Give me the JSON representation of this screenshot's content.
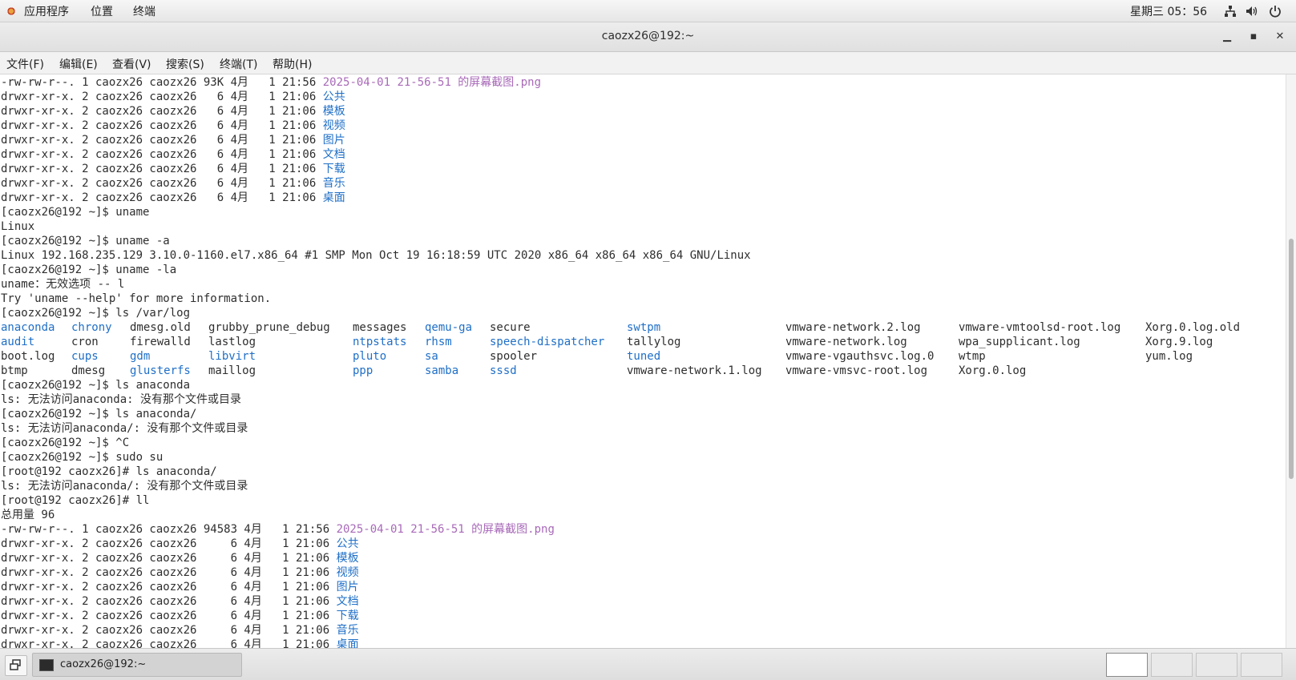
{
  "top_panel": {
    "applications": "应用程序",
    "places": "位置",
    "terminal": "终端",
    "clock": "星期三 05：56"
  },
  "window": {
    "title": "caozx26@192:~",
    "minimize": "▁",
    "maximize": "▪",
    "close": "✕"
  },
  "menubar": {
    "file": "文件(F)",
    "edit": "编辑(E)",
    "view": "查看(V)",
    "search": "搜索(S)",
    "terminal": "终端(T)",
    "help": "帮助(H)"
  },
  "terminal": {
    "lines": [
      {
        "text": "-rw-rw-r--. 1 caozx26 caozx26 93K 4月   1 21:56 ",
        "name": "2025-04-01 21-56-51 的屏幕截图.png",
        "kind": "img"
      },
      {
        "text": "drwxr-xr-x. 2 caozx26 caozx26   6 4月   1 21:06 ",
        "name": "公共",
        "kind": "dir"
      },
      {
        "text": "drwxr-xr-x. 2 caozx26 caozx26   6 4月   1 21:06 ",
        "name": "模板",
        "kind": "dir"
      },
      {
        "text": "drwxr-xr-x. 2 caozx26 caozx26   6 4月   1 21:06 ",
        "name": "视频",
        "kind": "dir"
      },
      {
        "text": "drwxr-xr-x. 2 caozx26 caozx26   6 4月   1 21:06 ",
        "name": "图片",
        "kind": "dir"
      },
      {
        "text": "drwxr-xr-x. 2 caozx26 caozx26   6 4月   1 21:06 ",
        "name": "文档",
        "kind": "dir"
      },
      {
        "text": "drwxr-xr-x. 2 caozx26 caozx26   6 4月   1 21:06 ",
        "name": "下载",
        "kind": "dir"
      },
      {
        "text": "drwxr-xr-x. 2 caozx26 caozx26   6 4月   1 21:06 ",
        "name": "音乐",
        "kind": "dir"
      },
      {
        "text": "drwxr-xr-x. 2 caozx26 caozx26   6 4月   1 21:06 ",
        "name": "桌面",
        "kind": "dir"
      },
      {
        "text": "[caozx26@192 ~]$ uname"
      },
      {
        "text": "Linux"
      },
      {
        "text": "[caozx26@192 ~]$ uname -a"
      },
      {
        "text": "Linux 192.168.235.129 3.10.0-1160.el7.x86_64 #1 SMP Mon Oct 19 16:18:59 UTC 2020 x86_64 x86_64 x86_64 GNU/Linux"
      },
      {
        "text": "[caozx26@192 ~]$ uname -la"
      },
      {
        "text": "uname：无效选项 -- l"
      },
      {
        "text": "Try 'uname --help' for more information."
      },
      {
        "text": "[caozx26@192 ~]$ ls /var/log"
      },
      {
        "cols": [
          {
            "t": "anaconda",
            "kind": "dir"
          },
          {
            "t": "chrony",
            "kind": "dir"
          },
          {
            "t": "dmesg.old"
          },
          {
            "t": "grubby_prune_debug"
          },
          {
            "t": "messages"
          },
          {
            "t": "qemu-ga",
            "kind": "dir"
          },
          {
            "t": "secure"
          },
          {
            "t": "swtpm",
            "kind": "dir"
          },
          {
            "t": "vmware-network.2.log"
          },
          {
            "t": "vmware-vmtoolsd-root.log"
          },
          {
            "t": "Xorg.0.log.old"
          }
        ]
      },
      {
        "cols": [
          {
            "t": "audit",
            "kind": "dir"
          },
          {
            "t": "cron"
          },
          {
            "t": "firewalld"
          },
          {
            "t": "lastlog"
          },
          {
            "t": "ntpstats",
            "kind": "dir"
          },
          {
            "t": "rhsm",
            "kind": "dir"
          },
          {
            "t": "speech-dispatcher",
            "kind": "dir"
          },
          {
            "t": "tallylog"
          },
          {
            "t": "vmware-network.log"
          },
          {
            "t": "wpa_supplicant.log"
          },
          {
            "t": "Xorg.9.log"
          }
        ]
      },
      {
        "cols": [
          {
            "t": "boot.log"
          },
          {
            "t": "cups",
            "kind": "dir"
          },
          {
            "t": "gdm",
            "kind": "dir"
          },
          {
            "t": "libvirt",
            "kind": "dir"
          },
          {
            "t": "pluto",
            "kind": "dir"
          },
          {
            "t": "sa",
            "kind": "dir"
          },
          {
            "t": "spooler"
          },
          {
            "t": "tuned",
            "kind": "dir"
          },
          {
            "t": "vmware-vgauthsvc.log.0"
          },
          {
            "t": "wtmp"
          },
          {
            "t": "yum.log"
          }
        ]
      },
      {
        "cols": [
          {
            "t": "btmp"
          },
          {
            "t": "dmesg"
          },
          {
            "t": "glusterfs",
            "kind": "dir"
          },
          {
            "t": "maillog"
          },
          {
            "t": "ppp",
            "kind": "dir"
          },
          {
            "t": "samba",
            "kind": "dir"
          },
          {
            "t": "sssd",
            "kind": "dir"
          },
          {
            "t": "vmware-network.1.log"
          },
          {
            "t": "vmware-vmsvc-root.log"
          },
          {
            "t": "Xorg.0.log"
          },
          {
            "t": ""
          }
        ]
      },
      {
        "text": "[caozx26@192 ~]$ ls anaconda"
      },
      {
        "text": "ls: 无法访问anaconda: 没有那个文件或目录"
      },
      {
        "text": "[caozx26@192 ~]$ ls anaconda/"
      },
      {
        "text": "ls: 无法访问anaconda/: 没有那个文件或目录"
      },
      {
        "text": "[caozx26@192 ~]$ ^C"
      },
      {
        "text": "[caozx26@192 ~]$ sudo su"
      },
      {
        "text": "[root@192 caozx26]# ls anaconda/"
      },
      {
        "text": "ls: 无法访问anaconda/: 没有那个文件或目录"
      },
      {
        "text": "[root@192 caozx26]# ll"
      },
      {
        "text": "总用量 96"
      },
      {
        "text": "-rw-rw-r--. 1 caozx26 caozx26 94583 4月   1 21:56 ",
        "name": "2025-04-01 21-56-51 的屏幕截图.png",
        "kind": "img"
      },
      {
        "text": "drwxr-xr-x. 2 caozx26 caozx26     6 4月   1 21:06 ",
        "name": "公共",
        "kind": "dir"
      },
      {
        "text": "drwxr-xr-x. 2 caozx26 caozx26     6 4月   1 21:06 ",
        "name": "模板",
        "kind": "dir"
      },
      {
        "text": "drwxr-xr-x. 2 caozx26 caozx26     6 4月   1 21:06 ",
        "name": "视频",
        "kind": "dir"
      },
      {
        "text": "drwxr-xr-x. 2 caozx26 caozx26     6 4月   1 21:06 ",
        "name": "图片",
        "kind": "dir"
      },
      {
        "text": "drwxr-xr-x. 2 caozx26 caozx26     6 4月   1 21:06 ",
        "name": "文档",
        "kind": "dir"
      },
      {
        "text": "drwxr-xr-x. 2 caozx26 caozx26     6 4月   1 21:06 ",
        "name": "下载",
        "kind": "dir"
      },
      {
        "text": "drwxr-xr-x. 2 caozx26 caozx26     6 4月   1 21:06 ",
        "name": "音乐",
        "kind": "dir"
      },
      {
        "text": "drwxr-xr-x. 2 caozx26 caozx26     6 4月   1 21:06 ",
        "name": "桌面",
        "kind": "dir"
      }
    ]
  },
  "taskbar": {
    "task_label": "caozx26@192:~"
  },
  "colors": {
    "directory": "#1f6fc7",
    "image_file": "#a86ab8",
    "text": "#2e2e2e"
  }
}
